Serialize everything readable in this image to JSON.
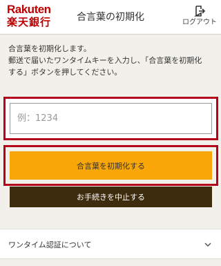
{
  "header": {
    "logo_top": "Rakuten",
    "logo_bottom": "楽天銀行",
    "title": "合言葉の初期化",
    "logout_label": "ログアウト"
  },
  "description": {
    "line1": "合言葉を初期化します。",
    "line2": "郵送で届いたワンタイムキーを入力し、「合言葉を初期化",
    "line3": "する」ボタンを押してください。"
  },
  "form": {
    "code_placeholder": "例：1234",
    "code_value": "",
    "submit_label": "合言葉を初期化する",
    "cancel_label": "お手続きを中止する"
  },
  "accordion": {
    "label": "ワンタイム認証について"
  },
  "colors": {
    "brand_red": "#bf0000",
    "highlight_border": "#b3001b",
    "primary_button": "#f8a608",
    "secondary_button": "#3e2c0f",
    "background": "#f2f0ea"
  }
}
